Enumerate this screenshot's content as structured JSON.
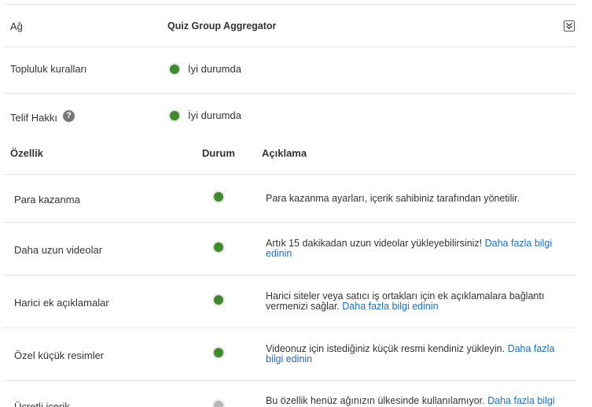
{
  "account": {
    "network_label": "Ağ",
    "network_value": "Quiz Group Aggregator",
    "community_label": "Topluluk kuralları",
    "community_status": "İyi durumda",
    "copyright_label": "Telif Hakkı",
    "copyright_status": "İyi durumda",
    "help_glyph": "?"
  },
  "table": {
    "headers": {
      "feature": "Özellik",
      "status": "Durum",
      "description": "Açıklama"
    },
    "rows": [
      {
        "name": "Para kazanma",
        "status": "enabled",
        "text": "Para kazanma ayarları, içerik sahibiniz tarafından yönetilir.",
        "link": ""
      },
      {
        "name": "Daha uzun videolar",
        "status": "enabled",
        "text": "Artık 15 dakikadan uzun videolar yükleyebilirsiniz! ",
        "link": "Daha fazla bilgi edinin"
      },
      {
        "name": "Harici ek açıklamalar",
        "status": "enabled",
        "text": "Harici siteler veya satıcı iş ortakları için ek açıklamalara bağlantı vermenizi sağlar. ",
        "link": "Daha fazla bilgi edinin"
      },
      {
        "name": "Özel küçük resimler",
        "status": "enabled",
        "text": "Videonuz için istediğiniz küçük resmi kendiniz yükleyin. ",
        "link": "Daha fazla bilgi edinin"
      },
      {
        "name": "Ücretli içerik",
        "status": "disabled",
        "text": "Bu özellik henüz ağınızın ülkesinde kullanılamıyor. ",
        "link": "Daha fazla bilgi"
      }
    ]
  },
  "colors": {
    "status_good": "#3f8a2b",
    "status_disabled": "#b8b8b8",
    "link": "#1a6fc4"
  },
  "icons": {
    "expand": "double-chevron-down-icon",
    "help": "question-circle-icon"
  }
}
